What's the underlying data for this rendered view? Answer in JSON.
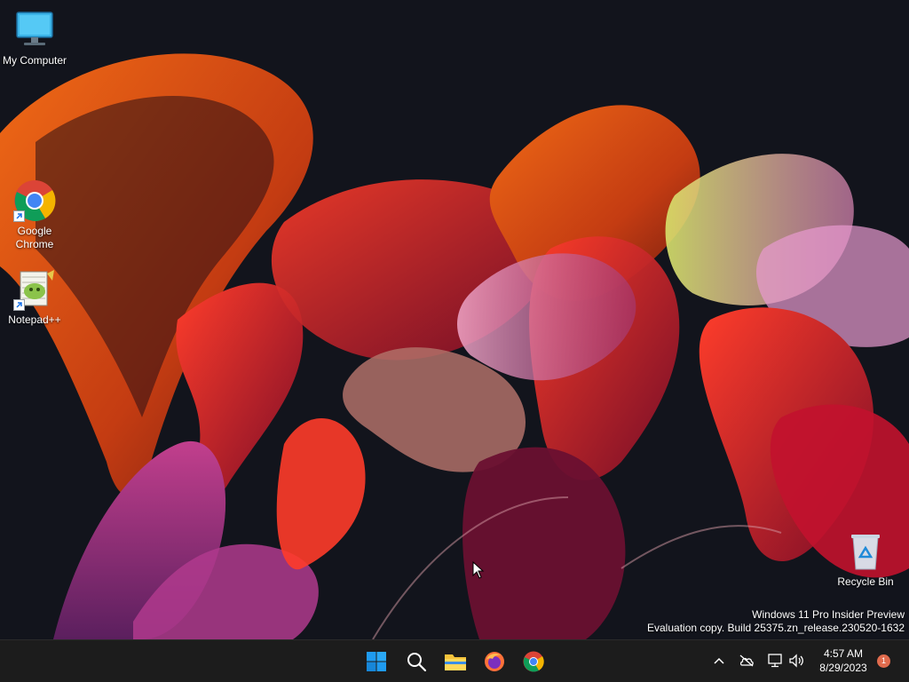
{
  "desktop": {
    "icons": [
      {
        "label": "My Computer",
        "icon": "monitor-icon"
      },
      {
        "label": "Google Chrome",
        "icon": "chrome-icon"
      },
      {
        "label": "Notepad++",
        "icon": "notepadpp-icon"
      },
      {
        "label": "Recycle Bin",
        "icon": "recycle-bin-icon"
      }
    ],
    "watermark": {
      "line1": "Windows 11 Pro Insider Preview",
      "line2": "Evaluation copy. Build 25375.zn_release.230520-1632"
    }
  },
  "taskbar": {
    "pinned": [
      {
        "name": "Start",
        "icon": "windows-start-icon"
      },
      {
        "name": "Search",
        "icon": "search-icon"
      },
      {
        "name": "File Explorer",
        "icon": "folder-icon"
      },
      {
        "name": "Firefox",
        "icon": "firefox-icon"
      },
      {
        "name": "Google Chrome",
        "icon": "chrome-icon"
      }
    ],
    "tray": {
      "icons": [
        "chevron-up-icon",
        "cloud-off-icon",
        "network-icon",
        "volume-icon"
      ]
    },
    "clock": {
      "time": "4:57 AM",
      "date": "8/29/2023"
    },
    "notification_count": "1"
  },
  "colors": {
    "taskbar_bg": "#1c1c1c",
    "desktop_bg": "#12141c",
    "accent_orange": "#e2561b",
    "accent_crimson": "#c0162f",
    "windows_blue": "#1f9bf0"
  }
}
